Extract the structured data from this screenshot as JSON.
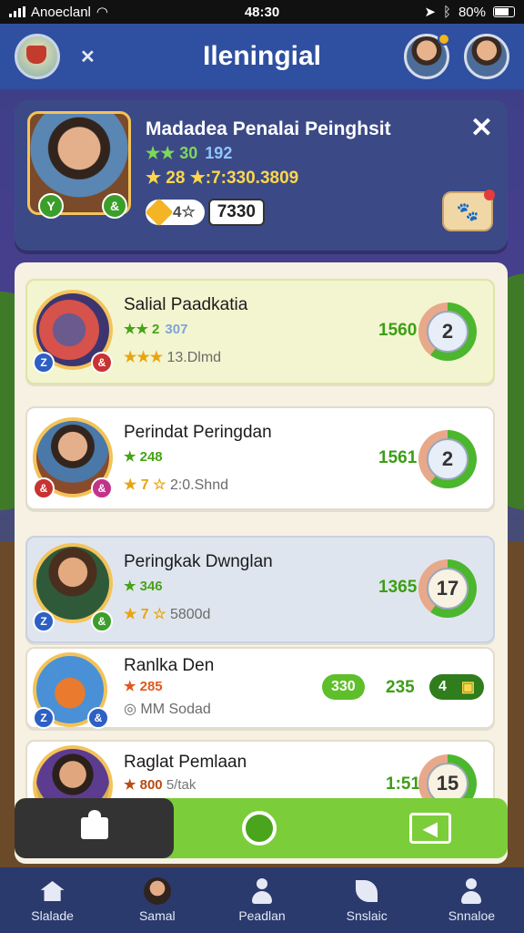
{
  "status_bar": {
    "carrier": "Anoeclanl",
    "time": "48:30",
    "battery": "80%"
  },
  "header": {
    "title": "Ileningial"
  },
  "profile": {
    "name": "Madadea Penalai Peinghsit",
    "stat_green": "★★ 30",
    "stat_blue": "192",
    "stat_gold": "★ 28 ★:7:330.3809",
    "currency": "4☆",
    "value": "7330"
  },
  "leaderboard": [
    {
      "name": "Salial Paadkatia",
      "stat1": "★★ 2",
      "stat1_blue": "307",
      "stat2_gold": "★★★",
      "stat2": "13.Dlmd",
      "score": "1560",
      "rank": "2"
    },
    {
      "name": "Perindat Peringdan",
      "stat1": "★ 248",
      "stat2_gold": "★ 7 ☆",
      "stat2": "2:0.Shnd",
      "score": "1561",
      "rank": "2"
    },
    {
      "name": "Peringkak Dwnglan",
      "stat1": "★ 346",
      "stat2_gold": "★ 7 ☆",
      "stat2": "5800d",
      "score": "1365",
      "rank": "17"
    },
    {
      "name": "Ranlka Den",
      "stat1": "★ 285",
      "stat2": "◎ MM Sodad",
      "score": "330",
      "score2": "235",
      "rank": "4"
    },
    {
      "name": "Raglat Pemlaan",
      "stat1": "★ 800",
      "stat1_extra": "5/tak",
      "score": "1:51",
      "rank": "15"
    }
  ],
  "bottom_nav": [
    {
      "label": "Slalade"
    },
    {
      "label": "Samal"
    },
    {
      "label": "Peadlan"
    },
    {
      "label": "Snslaic"
    },
    {
      "label": "Snnaloe"
    }
  ]
}
